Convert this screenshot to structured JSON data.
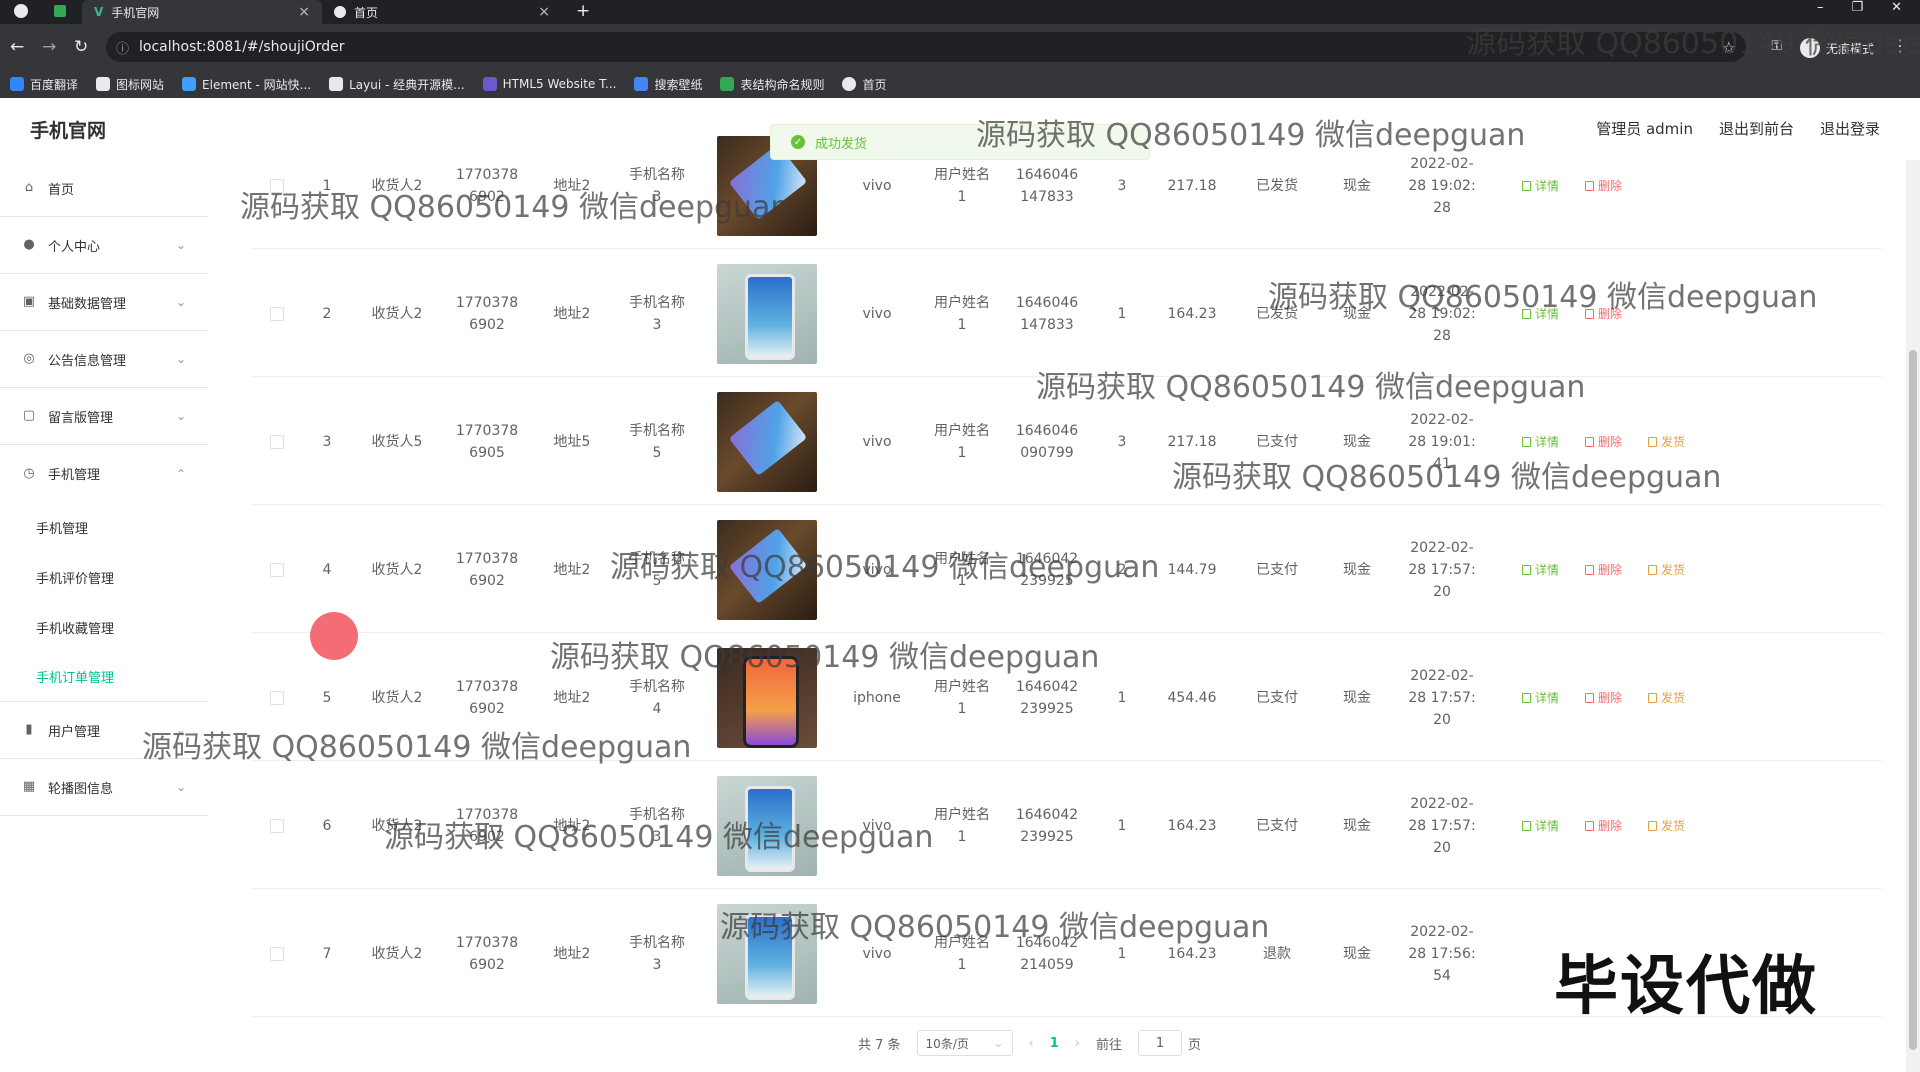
{
  "browser": {
    "tabs": [
      {
        "title": "手机官网",
        "active": true
      },
      {
        "title": "首页",
        "active": false
      }
    ],
    "new_tab": "+",
    "url": "localhost:8081/#/shoujiOrder",
    "incognito_label": "无痕模式",
    "bookmarks": [
      {
        "label": "百度翻译",
        "color": "#3385ff"
      },
      {
        "label": "图标网站",
        "color": "#e8eaed"
      },
      {
        "label": "Element - 网站快...",
        "color": "#409eff"
      },
      {
        "label": "Layui - 经典开源模...",
        "color": "#e8eaed"
      },
      {
        "label": "HTML5 Website T...",
        "color": "#6a5acd"
      },
      {
        "label": "搜索壁纸",
        "color": "#4285f4"
      },
      {
        "label": "表结构命名规则",
        "color": "#34a853"
      },
      {
        "label": "首页",
        "color": "#e8eaed"
      }
    ]
  },
  "header": {
    "logo": "手机官网",
    "links": [
      "管理员 admin",
      "退出到前台",
      "退出登录"
    ]
  },
  "toast": {
    "text": "成功发货"
  },
  "sidebar": {
    "items": [
      {
        "label": "首页",
        "icon": "home-icon",
        "expandable": false
      },
      {
        "label": "个人中心",
        "icon": "user-icon",
        "expandable": true
      },
      {
        "label": "基础数据管理",
        "icon": "data-icon",
        "expandable": true
      },
      {
        "label": "公告信息管理",
        "icon": "notice-icon",
        "expandable": true
      },
      {
        "label": "留言版管理",
        "icon": "message-icon",
        "expandable": true
      },
      {
        "label": "手机管理",
        "icon": "phone-icon",
        "expandable": true,
        "expanded": true
      }
    ],
    "sub_items": [
      {
        "label": "手机管理",
        "active": false
      },
      {
        "label": "手机评价管理",
        "active": false
      },
      {
        "label": "手机收藏管理",
        "active": false
      },
      {
        "label": "手机订单管理",
        "active": true
      }
    ],
    "bottom_items": [
      {
        "label": "用户管理",
        "icon": "chart-icon",
        "expandable": true
      },
      {
        "label": "轮播图信息",
        "icon": "image-icon",
        "expandable": true
      }
    ]
  },
  "table": {
    "rows": [
      {
        "idx": "1",
        "receiver": "收货人2",
        "phone": "1770378\n6902",
        "addr": "地址2",
        "name": "手机名称\n3",
        "img": "dark",
        "brand": "vivo",
        "user": "用户姓名\n1",
        "uphone": "1646046\n147833",
        "qty": "3",
        "price": "217.18",
        "status": "已发货",
        "pay": "现金",
        "time": "2022-02-\n28 19:02:\n28",
        "actions": [
          "详情",
          "删除"
        ]
      },
      {
        "idx": "2",
        "receiver": "收货人2",
        "phone": "1770378\n6902",
        "addr": "地址2",
        "name": "手机名称\n3",
        "img": "light",
        "brand": "vivo",
        "user": "用户姓名\n1",
        "uphone": "1646046\n147833",
        "qty": "1",
        "price": "164.23",
        "status": "已发货",
        "pay": "现金",
        "time": "2022-02-\n28 19:02:\n28",
        "actions": [
          "详情",
          "删除"
        ]
      },
      {
        "idx": "3",
        "receiver": "收货人5",
        "phone": "1770378\n6905",
        "addr": "地址5",
        "name": "手机名称\n5",
        "img": "dark",
        "brand": "vivo",
        "user": "用户姓名\n1",
        "uphone": "1646046\n090799",
        "qty": "3",
        "price": "217.18",
        "status": "已支付",
        "pay": "现金",
        "time": "2022-02-\n28 19:01:\n41",
        "actions": [
          "详情",
          "删除",
          "发货"
        ]
      },
      {
        "idx": "4",
        "receiver": "收货人2",
        "phone": "1770378\n6902",
        "addr": "地址2",
        "name": "手机名称\n5",
        "img": "dark",
        "brand": "vivo",
        "user": "用户姓名\n1",
        "uphone": "1646042\n239925",
        "qty": "2",
        "price": "144.79",
        "status": "已支付",
        "pay": "现金",
        "time": "2022-02-\n28 17:57:\n20",
        "actions": [
          "详情",
          "删除",
          "发货"
        ]
      },
      {
        "idx": "5",
        "receiver": "收货人2",
        "phone": "1770378\n6902",
        "addr": "地址2",
        "name": "手机名称\n4",
        "img": "orange",
        "brand": "iphone",
        "user": "用户姓名\n1",
        "uphone": "1646042\n239925",
        "qty": "1",
        "price": "454.46",
        "status": "已支付",
        "pay": "现金",
        "time": "2022-02-\n28 17:57:\n20",
        "actions": [
          "详情",
          "删除",
          "发货"
        ]
      },
      {
        "idx": "6",
        "receiver": "收货人2",
        "phone": "1770378\n6902",
        "addr": "地址2",
        "name": "手机名称\n3",
        "img": "light",
        "brand": "vivo",
        "user": "用户姓名\n1",
        "uphone": "1646042\n239925",
        "qty": "1",
        "price": "164.23",
        "status": "已支付",
        "pay": "现金",
        "time": "2022-02-\n28 17:57:\n20",
        "actions": [
          "详情",
          "删除",
          "发货"
        ]
      },
      {
        "idx": "7",
        "receiver": "收货人2",
        "phone": "1770378\n6902",
        "addr": "地址2",
        "name": "手机名称\n3",
        "img": "light",
        "brand": "vivo",
        "user": "用户姓名\n1",
        "uphone": "1646042\n214059",
        "qty": "1",
        "price": "164.23",
        "status": "退款",
        "pay": "现金",
        "time": "2022-02-\n28 17:56:\n54",
        "actions": []
      }
    ]
  },
  "pagination": {
    "total": "共 7 条",
    "page_size": "10条/页",
    "current": "1",
    "goto_prefix": "前往",
    "goto_value": "1",
    "goto_suffix": "页"
  },
  "watermark": {
    "text": "源码获取 QQ86050149 微信deepguan",
    "stamp": "毕设代做"
  },
  "colors": {
    "accent": "#00c292",
    "success": "#67c23a",
    "danger": "#f56c6c",
    "warning": "#e6a23c"
  }
}
